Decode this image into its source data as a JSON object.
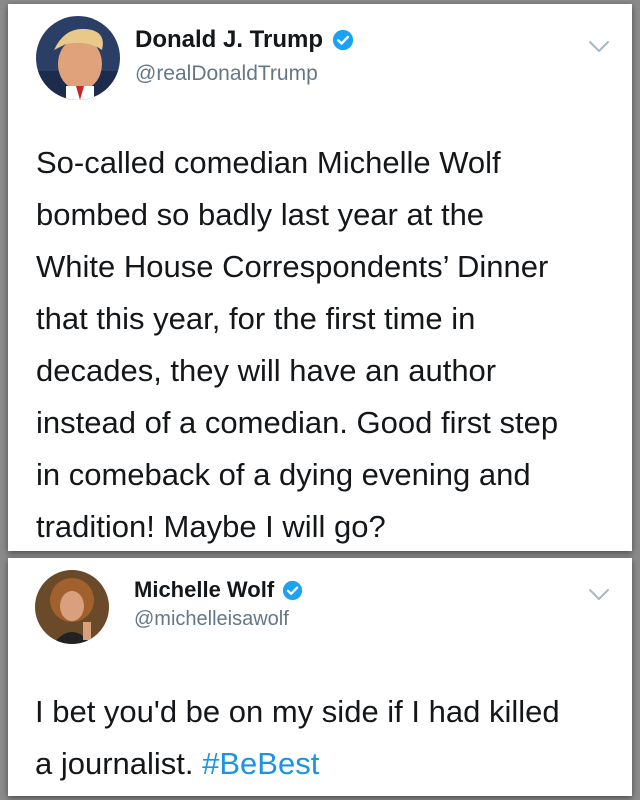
{
  "tweets": [
    {
      "display_name": "Donald J. Trump",
      "handle": "@realDonaldTrump",
      "verified": true,
      "text": "So-called comedian Michelle Wolf\nbombed so badly last year at the\nWhite House Correspondents’ Dinner\nthat this year, for the first time in\ndecades, they will have an author\ninstead of a comedian. Good first step\nin comeback of a dying evening and\ntradition! Maybe I will go?",
      "avatar_icon": "profile-photo",
      "menu_icon": "chevron-down-icon"
    },
    {
      "display_name": "Michelle Wolf",
      "handle": "@michelleisawolf",
      "verified": true,
      "text": "I bet you'd be on my side if I had killed\na journalist. ",
      "hashtag": "#BeBest",
      "avatar_icon": "profile-photo",
      "menu_icon": "chevron-down-icon"
    }
  ],
  "colors": {
    "name": "#14171a",
    "handle": "#657786",
    "verified": "#1da1f2",
    "hashtag": "#1b95e0",
    "chevron": "#aab8c2"
  }
}
